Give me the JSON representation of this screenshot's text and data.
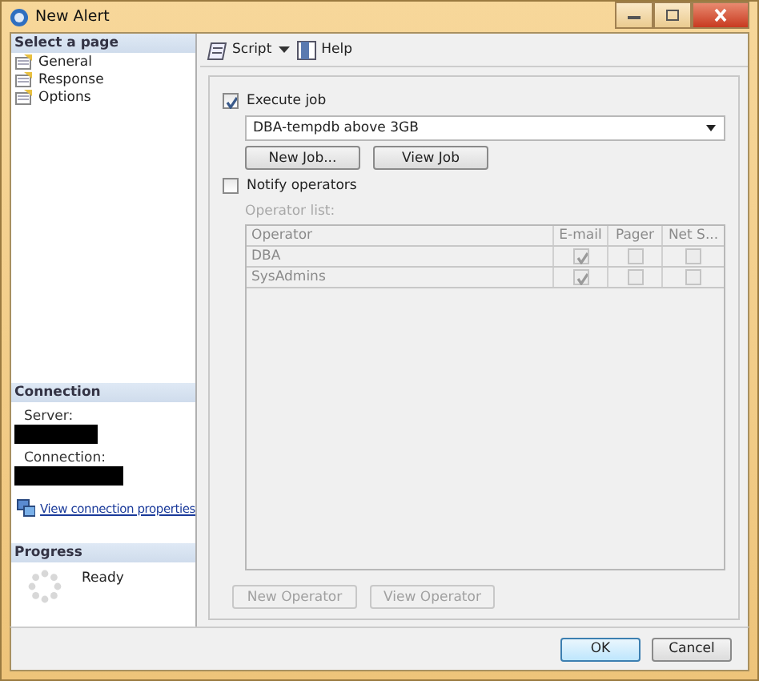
{
  "window": {
    "title": "New Alert"
  },
  "sidebar": {
    "header": "Select a page",
    "items": [
      {
        "label": "General",
        "selected": false
      },
      {
        "label": "Response",
        "selected": false
      },
      {
        "label": "Options",
        "selected": false
      }
    ]
  },
  "connection": {
    "header": "Connection",
    "server_label": "Server:",
    "connection_label": "Connection:",
    "link": "View connection properties"
  },
  "progress": {
    "header": "Progress",
    "status": "Ready"
  },
  "toolbar": {
    "script": "Script",
    "help": "Help"
  },
  "execute_job": {
    "label": "Execute job",
    "checked": true,
    "job": "DBA-tempdb above 3GB",
    "buttons": [
      "New Job...",
      "View Job"
    ]
  },
  "notify": {
    "label": "Notify operators",
    "checked": false,
    "list_label": "Operator list:"
  },
  "operators": {
    "disabled": true,
    "columns": [
      "Operator",
      "E-mail",
      "Pager",
      "Net S..."
    ],
    "rows": [
      {
        "name": "DBA",
        "email": true,
        "pager": false,
        "net_send": false
      },
      {
        "name": "SysAdmins",
        "email": true,
        "pager": false,
        "net_send": false
      }
    ]
  },
  "operator_buttons": [
    "New Operator",
    "View Operator"
  ],
  "dialog_buttons": [
    "OK",
    "Cancel"
  ]
}
